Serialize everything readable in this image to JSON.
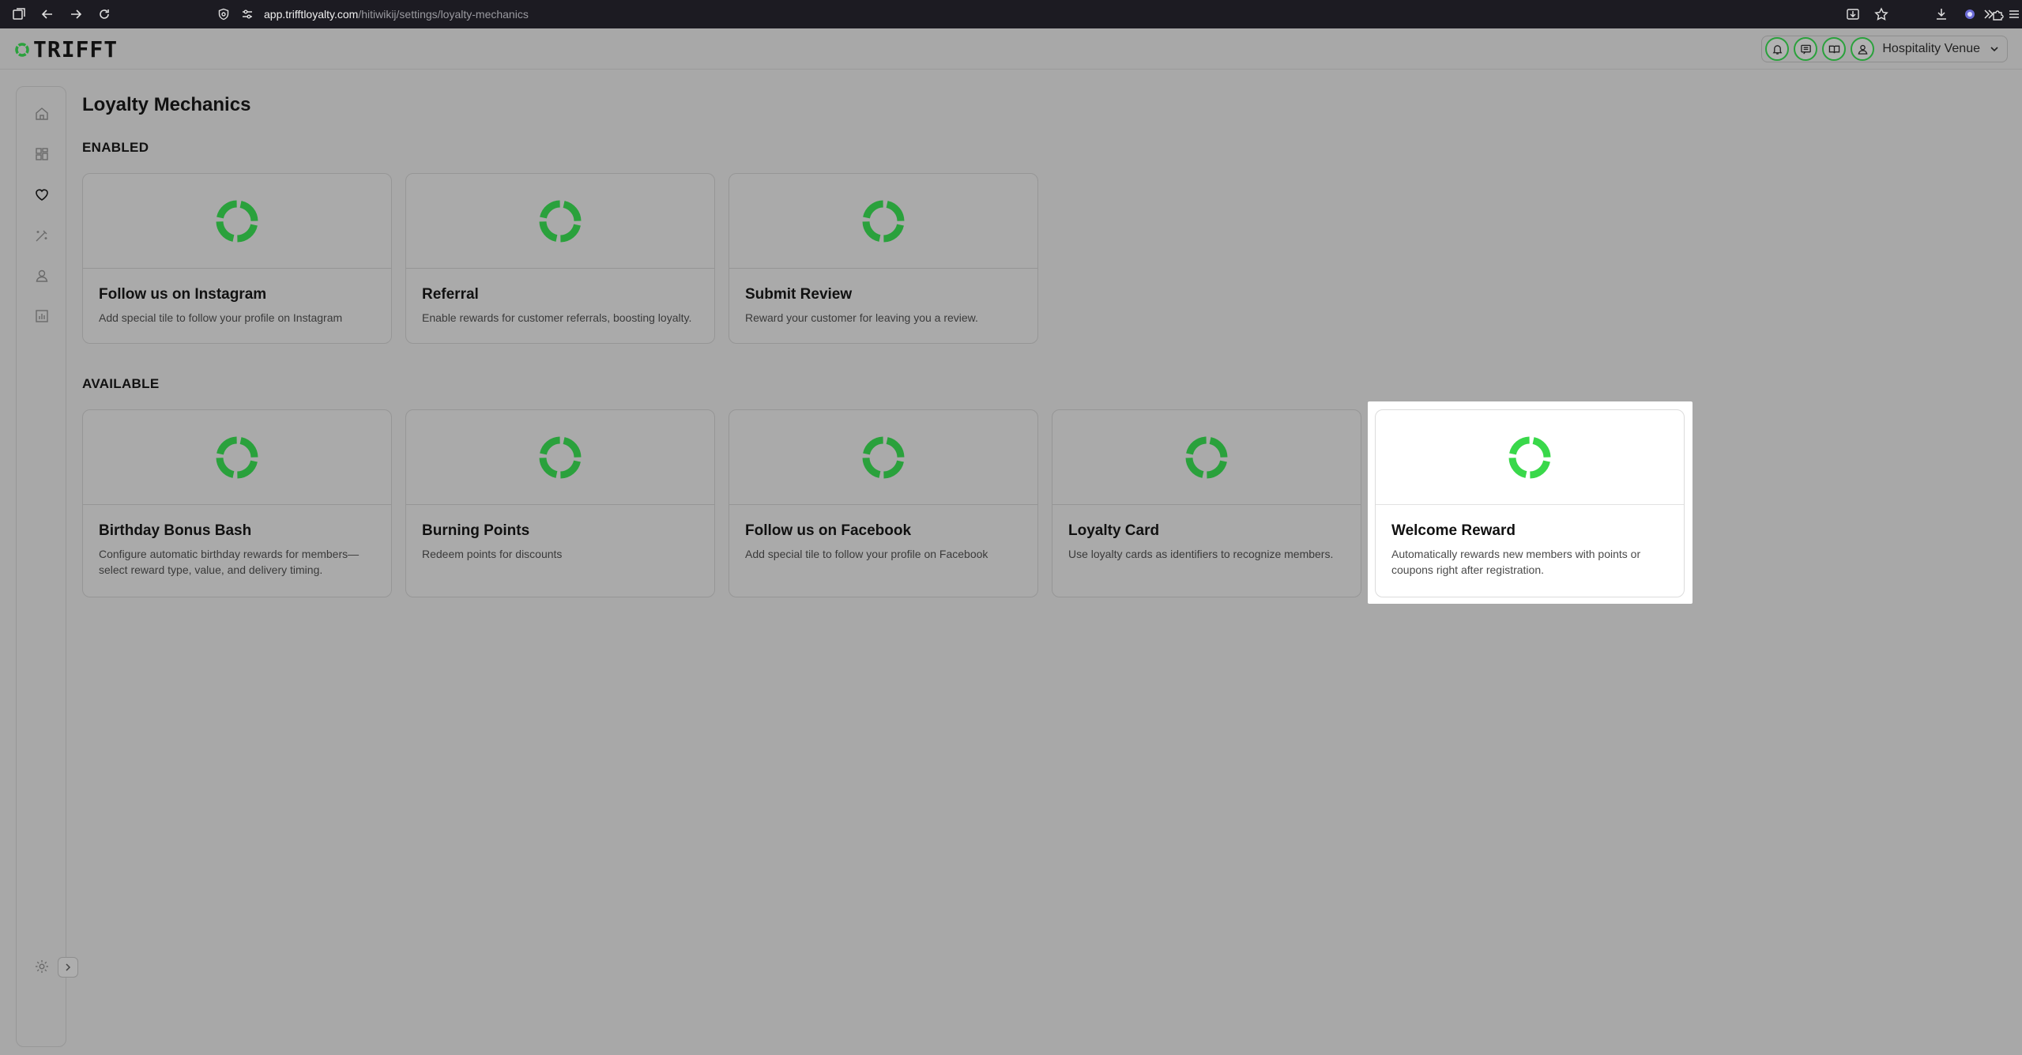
{
  "browser": {
    "url_domain": "app.trifftloyalty.com",
    "url_path": "/hitiwikij/settings/loyalty-mechanics"
  },
  "header": {
    "logo_text": "TRIFFT",
    "venue_label": "Hospitality Venue"
  },
  "page": {
    "title": "Loyalty Mechanics"
  },
  "sections": {
    "enabled_label": "ENABLED",
    "available_label": "AVAILABLE"
  },
  "enabled": [
    {
      "title": "Follow us on Instagram",
      "description": "Add special tile to follow your profile on Instagram"
    },
    {
      "title": "Referral",
      "description": "Enable rewards for customer referrals, boosting loyalty."
    },
    {
      "title": "Submit Review",
      "description": "Reward your customer for leaving you a review."
    }
  ],
  "available": [
    {
      "title": "Birthday Bonus Bash",
      "description": "Configure automatic birthday rewards for members—select reward type, value, and delivery timing."
    },
    {
      "title": "Burning Points",
      "description": "Redeem points for discounts"
    },
    {
      "title": "Follow us on Facebook",
      "description": "Add special tile to follow your profile on Facebook"
    },
    {
      "title": "Loyalty Card",
      "description": "Use loyalty cards as identifiers to recognize members."
    },
    {
      "title": "Welcome Reward",
      "description": "Automatically rewards new members with points or coupons right after registration."
    }
  ],
  "colors": {
    "accent_green": "#2aa13c",
    "highlight_green": "#39d84a",
    "overlay_bg": "#a8a8a8"
  },
  "icons": {
    "sidebar": [
      "home-icon",
      "dashboard-icon",
      "heart-icon",
      "magic-wand-icon",
      "user-icon",
      "chart-icon",
      "settings-icon"
    ],
    "header": [
      "bell-icon",
      "message-icon",
      "book-icon",
      "user-icon",
      "chevron-down-icon"
    ]
  }
}
